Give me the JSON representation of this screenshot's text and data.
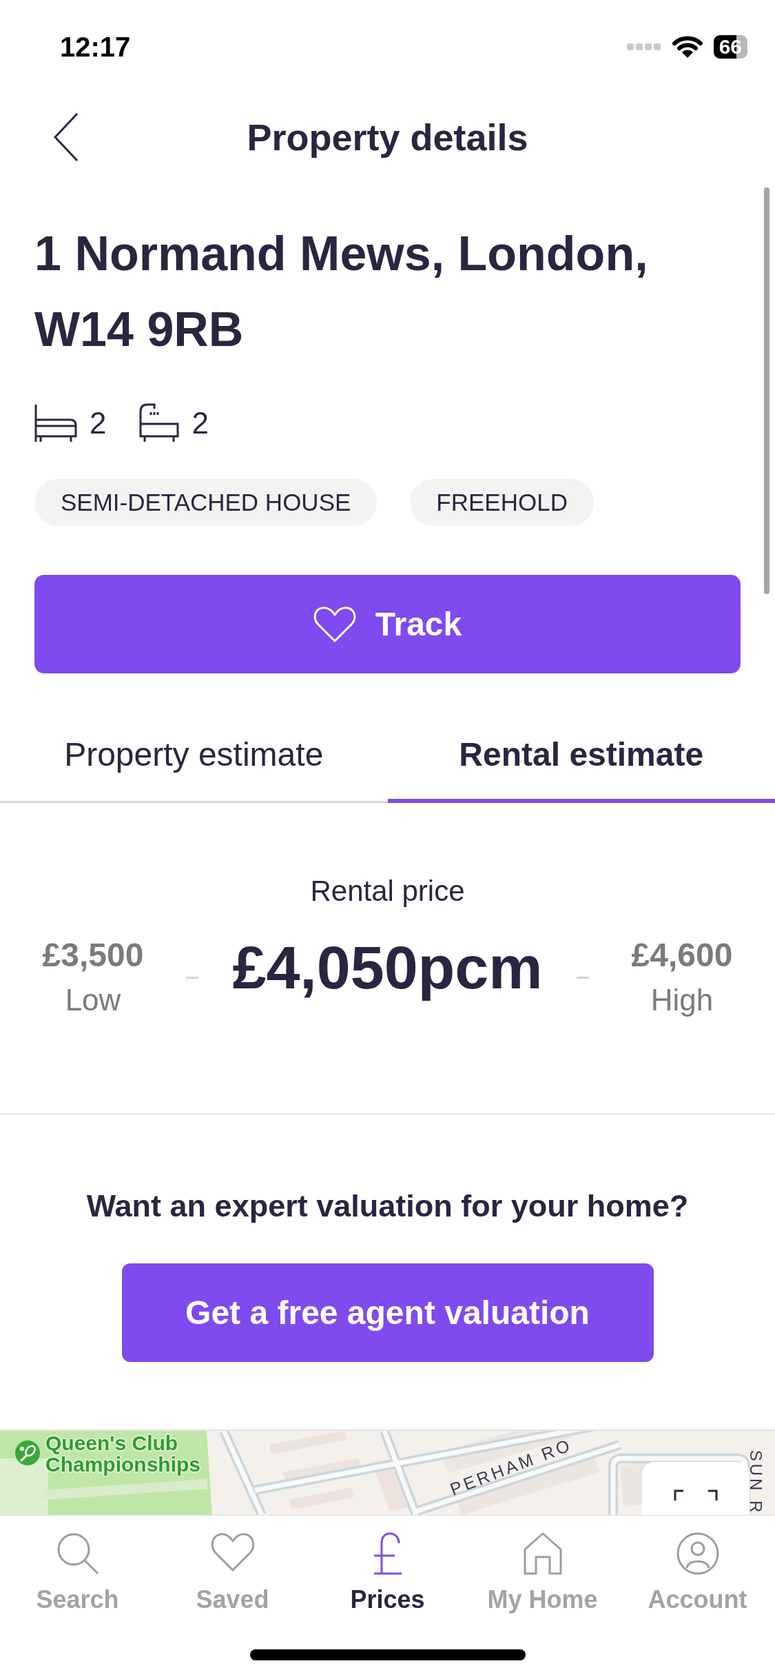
{
  "status_bar": {
    "time": "12:17",
    "battery": "66"
  },
  "header": {
    "title": "Property details"
  },
  "property": {
    "address": "1 Normand Mews, London, W14 9RB",
    "features": [
      {
        "kind": "bedrooms",
        "count": "2"
      },
      {
        "kind": "bathrooms",
        "count": "2"
      }
    ],
    "tags": [
      "SEMI-DETACHED HOUSE",
      "FREEHOLD"
    ]
  },
  "track_button": {
    "label": "Track"
  },
  "tabs": [
    {
      "label": "Property estimate",
      "selected": false
    },
    {
      "label": "Rental estimate",
      "selected": true
    }
  ],
  "estimate": {
    "title": "Rental price",
    "low": {
      "value": "£3,500",
      "label": "Low"
    },
    "main": "£4,050pcm",
    "high": {
      "value": "£4,600",
      "label": "High"
    }
  },
  "valuation": {
    "question": "Want an expert valuation for your home?",
    "button": "Get a free agent valuation"
  },
  "map": {
    "labels": [
      {
        "kind": "poi",
        "text": "Queen's Club Championships"
      },
      {
        "kind": "street",
        "text": "PERHAM RO"
      },
      {
        "kind": "street_vertical",
        "text": "SUN R"
      }
    ]
  },
  "bottom_nav": [
    {
      "kind": "search",
      "label": "Search",
      "selected": false
    },
    {
      "kind": "saved",
      "label": "Saved",
      "selected": false
    },
    {
      "kind": "prices",
      "label": "Prices",
      "selected": true
    },
    {
      "kind": "home",
      "label": "My Home",
      "selected": false
    },
    {
      "kind": "account",
      "label": "Account",
      "selected": false
    }
  ]
}
